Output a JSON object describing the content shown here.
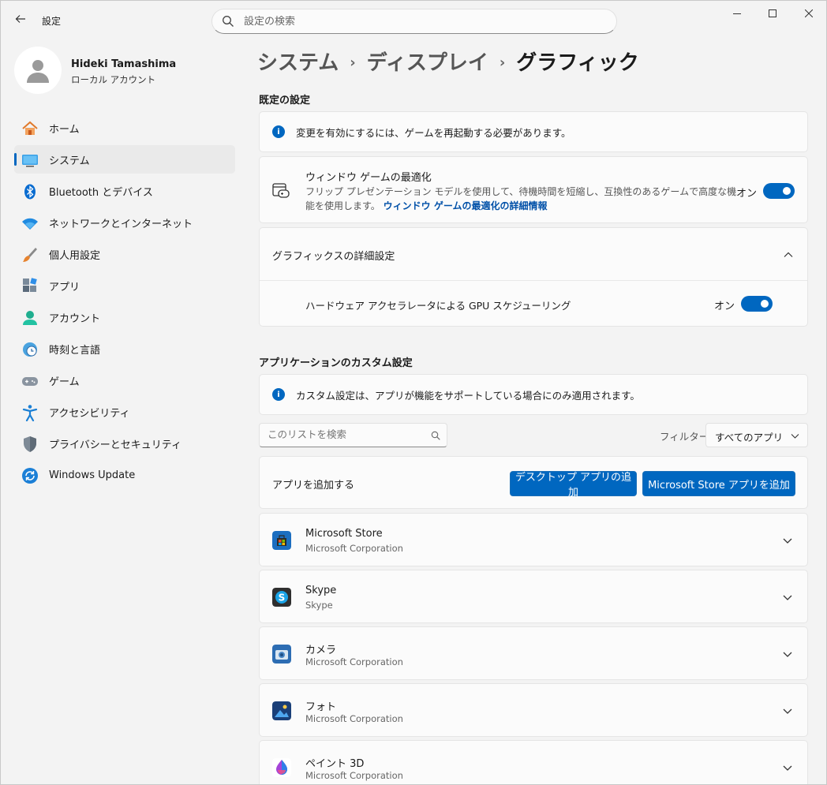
{
  "window": {
    "title": "設定",
    "back_icon": "back-arrow-icon"
  },
  "search": {
    "placeholder": "設定の検索"
  },
  "profile": {
    "name": "Hideki Tamashima",
    "account_type": "ローカル アカウント"
  },
  "nav": {
    "items": [
      {
        "label": "ホーム",
        "icon": "home-icon",
        "active": false
      },
      {
        "label": "システム",
        "icon": "system-icon",
        "active": true
      },
      {
        "label": "Bluetooth とデバイス",
        "icon": "bluetooth-icon",
        "active": false
      },
      {
        "label": "ネットワークとインターネット",
        "icon": "wifi-icon",
        "active": false
      },
      {
        "label": "個人用設定",
        "icon": "brush-icon",
        "active": false
      },
      {
        "label": "アプリ",
        "icon": "apps-icon",
        "active": false
      },
      {
        "label": "アカウント",
        "icon": "account-icon",
        "active": false
      },
      {
        "label": "時刻と言語",
        "icon": "time-language-icon",
        "active": false
      },
      {
        "label": "ゲーム",
        "icon": "gamepad-icon",
        "active": false
      },
      {
        "label": "アクセシビリティ",
        "icon": "accessibility-icon",
        "active": false
      },
      {
        "label": "プライバシーとセキュリティ",
        "icon": "shield-icon",
        "active": false
      },
      {
        "label": "Windows Update",
        "icon": "windows-update-icon",
        "active": false
      }
    ]
  },
  "breadcrumb": {
    "level1": "システム",
    "level2": "ディスプレイ",
    "current": "グラフィック",
    "separator": "›"
  },
  "defaults": {
    "section_title": "既定の設定",
    "restart_notice": "変更を有効にするには、ゲームを再起動する必要があります。",
    "window_game": {
      "title": "ウィンドウ ゲームの最適化",
      "description_line1": "フリップ プレゼンテーション モデルを使用して、待機時間を短縮し、互換性のあるゲームで高度な機",
      "description_line2": "能を使用します。",
      "link": "ウィンドウ ゲームの最適化の詳細情報",
      "state_label": "オン",
      "state": true
    },
    "advanced": {
      "title": "グラフィックスの詳細設定",
      "expanded": true,
      "gpu_scheduling": {
        "label": "ハードウェア アクセラレータによる GPU スケジューリング",
        "state_label": "オン",
        "state": true
      }
    }
  },
  "custom": {
    "section_title": "アプリケーションのカスタム設定",
    "notice": "カスタム設定は、アプリが機能をサポートしている場合にのみ適用されます。",
    "list_search_placeholder": "このリストを検索",
    "filter_label": "フィルター:",
    "filter_value": "すべてのアプリ",
    "add_app_label": "アプリを追加する",
    "add_desktop_button": "デスクトップ アプリの追加",
    "add_store_button": "Microsoft Store アプリを追加",
    "apps": [
      {
        "name": "Microsoft Store",
        "publisher": "Microsoft Corporation",
        "icon": "microsoft-store-icon"
      },
      {
        "name": "Skype",
        "publisher": "Skype",
        "icon": "skype-icon"
      },
      {
        "name": "カメラ",
        "publisher": "Microsoft Corporation",
        "icon": "camera-icon"
      },
      {
        "name": "フォト",
        "publisher": "Microsoft Corporation",
        "icon": "photos-icon"
      },
      {
        "name": "ペイント 3D",
        "publisher": "Microsoft Corporation",
        "icon": "paint-3d-icon"
      }
    ]
  },
  "colors": {
    "accent": "#0067c0",
    "background": "#f3f3f3",
    "card": "#fbfbfb"
  }
}
